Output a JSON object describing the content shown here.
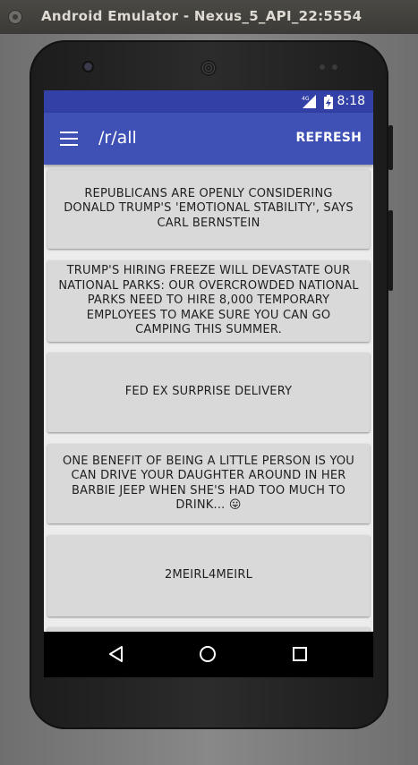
{
  "window": {
    "title": "Android Emulator - Nexus_5_API_22:5554"
  },
  "status_bar": {
    "network": "4G",
    "time": "8:18"
  },
  "app_bar": {
    "title": "/r/all",
    "refresh_label": "REFRESH",
    "color": "#3f51b5",
    "status_color": "#3340a6"
  },
  "posts": [
    {
      "title": "REPUBLICANS ARE OPENLY CONSIDERING DONALD TRUMP'S 'EMOTIONAL STABILITY', SAYS CARL BERNSTEIN"
    },
    {
      "title": "TRUMP'S HIRING FREEZE WILL DEVASTATE OUR NATIONAL PARKS: OUR OVERCROWDED NATIONAL PARKS NEED TO HIRE 8,000 TEMPORARY EMPLOYEES TO MAKE SURE YOU CAN GO CAMPING THIS SUMMER."
    },
    {
      "title": "FED EX SURPRISE DELIVERY"
    },
    {
      "title": "ONE BENEFIT OF BEING A LITTLE PERSON IS YOU CAN DRIVE YOUR DAUGHTER AROUND IN HER BARBIE JEEP WHEN SHE'S HAD TOO MUCH TO DRINK... 😛"
    },
    {
      "title": "2MEIRL4MEIRL"
    }
  ],
  "nav_bar": {
    "back_icon": "back-triangle-icon",
    "home_icon": "home-circle-icon",
    "recents_icon": "recents-square-icon"
  }
}
